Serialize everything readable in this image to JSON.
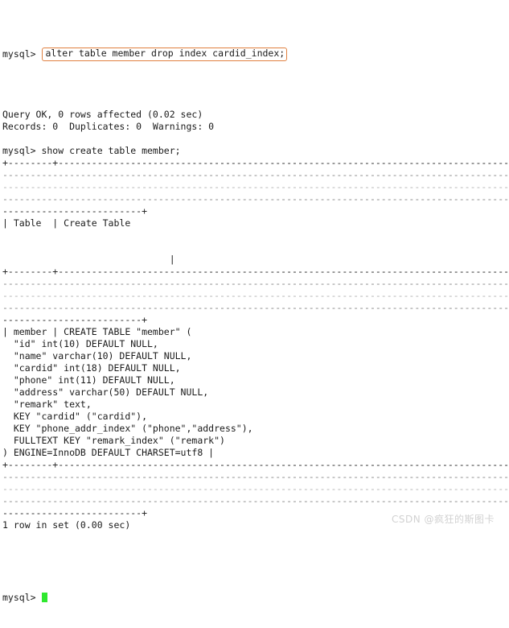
{
  "terminal": {
    "prompt": "mysql> ",
    "highlighted_command": "alter table member drop index cardid_index;",
    "lines": [
      {
        "id": "alter-result-1",
        "text": "Query OK, 0 rows affected (0.02 sec)",
        "style": "normal"
      },
      {
        "id": "alter-result-2",
        "text": "Records: 0  Duplicates: 0  Warnings: 0",
        "style": "normal"
      },
      {
        "id": "blank-1",
        "text": "",
        "style": "blank"
      },
      {
        "id": "show-create-command",
        "text": "mysql> show create table member;",
        "style": "normal"
      },
      {
        "id": "rule-top-1",
        "text": "+--------+------------------------------------------------------------------------------------------",
        "style": "rule"
      },
      {
        "id": "rule-top-2",
        "text": "------------------------------------------------------------------------------------------------",
        "style": "rule-faint"
      },
      {
        "id": "rule-top-3",
        "text": "------------------------------------------------------------------------------------------------",
        "style": "rule-veryfaint"
      },
      {
        "id": "rule-top-4",
        "text": "------------------------------------------------------------------------------------------------",
        "style": "rule-faint"
      },
      {
        "id": "rule-top-5",
        "text": "-------------------------+",
        "style": "rule"
      },
      {
        "id": "header-row",
        "text": "| Table  | Create Table",
        "style": "normal"
      },
      {
        "id": "blank-2",
        "text": "",
        "style": "blank"
      },
      {
        "id": "blank-3",
        "text": "",
        "style": "blank"
      },
      {
        "id": "header-row-tail",
        "text": "                              |",
        "style": "normal"
      },
      {
        "id": "rule-mid-1",
        "text": "+--------+------------------------------------------------------------------------------------------",
        "style": "rule"
      },
      {
        "id": "rule-mid-2",
        "text": "------------------------------------------------------------------------------------------------",
        "style": "rule-faint"
      },
      {
        "id": "rule-mid-3",
        "text": "------------------------------------------------------------------------------------------------",
        "style": "rule-veryfaint"
      },
      {
        "id": "rule-mid-4",
        "text": "------------------------------------------------------------------------------------------------",
        "style": "rule-faint"
      },
      {
        "id": "rule-mid-5",
        "text": "-------------------------+",
        "style": "rule"
      },
      {
        "id": "ddl-1",
        "text": "| member | CREATE TABLE \"member\" (",
        "style": "normal"
      },
      {
        "id": "ddl-2",
        "text": "  \"id\" int(10) DEFAULT NULL,",
        "style": "normal"
      },
      {
        "id": "ddl-3",
        "text": "  \"name\" varchar(10) DEFAULT NULL,",
        "style": "normal"
      },
      {
        "id": "ddl-4",
        "text": "  \"cardid\" int(18) DEFAULT NULL,",
        "style": "normal"
      },
      {
        "id": "ddl-5",
        "text": "  \"phone\" int(11) DEFAULT NULL,",
        "style": "normal"
      },
      {
        "id": "ddl-6",
        "text": "  \"address\" varchar(50) DEFAULT NULL,",
        "style": "normal"
      },
      {
        "id": "ddl-7",
        "text": "  \"remark\" text,",
        "style": "normal"
      },
      {
        "id": "ddl-8",
        "text": "  KEY \"cardid\" (\"cardid\"),",
        "style": "normal"
      },
      {
        "id": "ddl-9",
        "text": "  KEY \"phone_addr_index\" (\"phone\",\"address\"),",
        "style": "normal"
      },
      {
        "id": "ddl-10",
        "text": "  FULLTEXT KEY \"remark_index\" (\"remark\")",
        "style": "normal"
      },
      {
        "id": "ddl-11",
        "text": ") ENGINE=InnoDB DEFAULT CHARSET=utf8 |",
        "style": "normal"
      },
      {
        "id": "rule-bot-1",
        "text": "+--------+------------------------------------------------------------------------------------------",
        "style": "rule"
      },
      {
        "id": "rule-bot-2",
        "text": "------------------------------------------------------------------------------------------------",
        "style": "rule-faint"
      },
      {
        "id": "rule-bot-3",
        "text": "------------------------------------------------------------------------------------------------",
        "style": "rule-veryfaint"
      },
      {
        "id": "rule-bot-4",
        "text": "------------------------------------------------------------------------------------------------",
        "style": "rule-faint"
      },
      {
        "id": "rule-bot-5",
        "text": "-------------------------+",
        "style": "rule"
      },
      {
        "id": "row-count",
        "text": "1 row in set (0.00 sec)",
        "style": "normal"
      },
      {
        "id": "blank-4",
        "text": "",
        "style": "blank"
      }
    ],
    "final_prompt": "mysql> ",
    "cursor_color": "#2fe82f",
    "highlight_border_color": "#e08040",
    "background_color": "#ffffff",
    "text_color": "#1a1a1a"
  },
  "watermark": {
    "text": "CSDN @疯狂的斯图卡",
    "color": "#d2d2d2"
  }
}
